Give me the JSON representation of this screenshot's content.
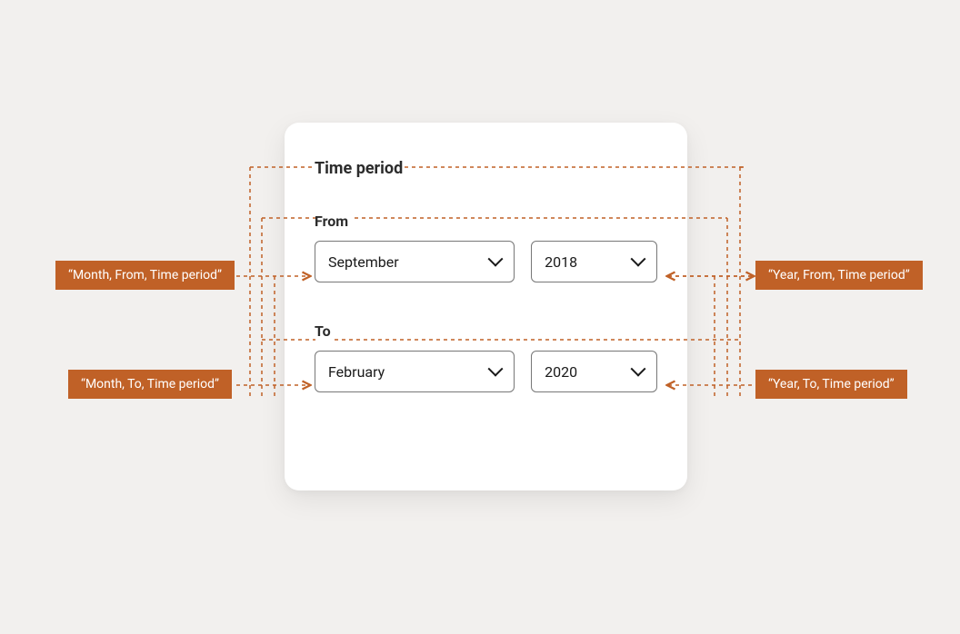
{
  "card": {
    "title": "Time period",
    "from": {
      "label": "From",
      "month": "September",
      "year": "2018"
    },
    "to": {
      "label": "To",
      "month": "February",
      "year": "2020"
    }
  },
  "annotations": {
    "month_from": "“Month, From, Time period”",
    "year_from": "“Year, From, Time period”",
    "month_to": "“Month, To, Time period”",
    "year_to": "“Year, To, Time period”"
  }
}
